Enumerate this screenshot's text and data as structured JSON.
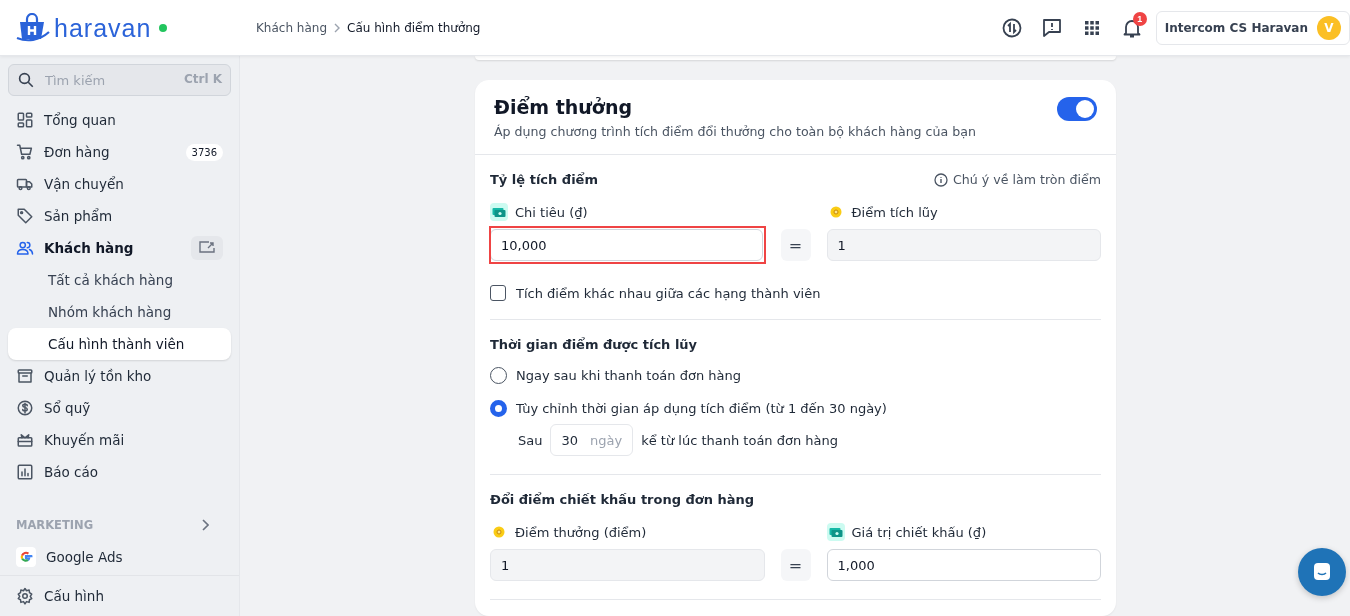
{
  "header": {
    "logo_text": "haravan",
    "online": true,
    "breadcrumb": [
      {
        "label": "Khách hàng",
        "current": false
      },
      {
        "label": "Cấu hình điểm thưởng",
        "current": true
      }
    ],
    "actions": [
      {
        "kind": "sync"
      },
      {
        "kind": "feedback"
      },
      {
        "kind": "apps"
      },
      {
        "kind": "bell",
        "count": "1"
      }
    ],
    "account": {
      "name": "Intercom CS Haravan",
      "initial": "V"
    }
  },
  "sidebar": {
    "search": {
      "placeholder": "Tìm kiếm",
      "shortcut": "Ctrl K"
    },
    "items": [
      {
        "label": "Tổng quan",
        "selected": false
      },
      {
        "label": "Đơn hàng",
        "badge": "3736",
        "selected": false
      },
      {
        "label": "Vận chuyển",
        "selected": false
      },
      {
        "label": "Sản phẩm",
        "selected": false
      },
      {
        "label": "Khách hàng",
        "selected": true,
        "children": [
          {
            "label": "Tất cả khách hàng",
            "selected": false
          },
          {
            "label": "Nhóm khách hàng",
            "selected": false
          },
          {
            "label": "Cấu hình thành viên",
            "selected": true
          }
        ]
      },
      {
        "label": "Quản lý tồn kho",
        "selected": false
      },
      {
        "label": "Sổ quỹ",
        "selected": false
      },
      {
        "label": "Khuyến mãi",
        "selected": false
      },
      {
        "label": "Báo cáo",
        "selected": false
      }
    ],
    "section_title": "MARKETING",
    "section_items": [
      {
        "label": "Google Ads",
        "selected": false
      }
    ],
    "footer_items": [
      {
        "label": "Cấu hình",
        "selected": false
      }
    ]
  },
  "card": {
    "title": "Điểm thưởng",
    "description": "Áp dụng chương trình tích điểm đổi thưởng cho toàn bộ khách hàng của bạn",
    "enabled": true,
    "sections": [
      {
        "kind": "ratio",
        "title": "Tỷ lệ tích điểm",
        "note": "Chú ý về làm tròn điểm",
        "equals": "=",
        "fields": [
          {
            "kind": "money",
            "label": "Chi tiêu (₫)",
            "value": "10,000",
            "disabled": false,
            "highlighted": true
          },
          {
            "kind": "points",
            "label": "Điểm tích lũy",
            "value": "1",
            "disabled": true,
            "highlighted": false
          }
        ],
        "checkbox": {
          "label": "Tích điểm khác nhau giữa các hạng thành viên",
          "checked": false
        }
      },
      {
        "kind": "timing",
        "title": "Thời gian điểm được tích lũy",
        "radios": [
          {
            "label": "Ngay sau khi thanh toán đơn hàng",
            "selected": false
          },
          {
            "label": "Tùy chỉnh thời gian áp dụng tích điểm (từ 1 đến 30 ngày)",
            "selected": true
          }
        ],
        "delay": {
          "prefix": "Sau",
          "value": "30",
          "unit": "ngày",
          "suffix": "kể từ lúc thanh toán đơn hàng"
        }
      },
      {
        "kind": "ratio",
        "title": "Đổi điểm chiết khấu trong đơn hàng",
        "equals": "=",
        "fields": [
          {
            "kind": "points",
            "label": "Điểm thưởng (điểm)",
            "value": "1",
            "disabled": true,
            "highlighted": false
          },
          {
            "kind": "money",
            "label": "Giá trị chiết khấu (₫)",
            "value": "1,000",
            "disabled": false,
            "highlighted": false
          }
        ]
      }
    ]
  }
}
